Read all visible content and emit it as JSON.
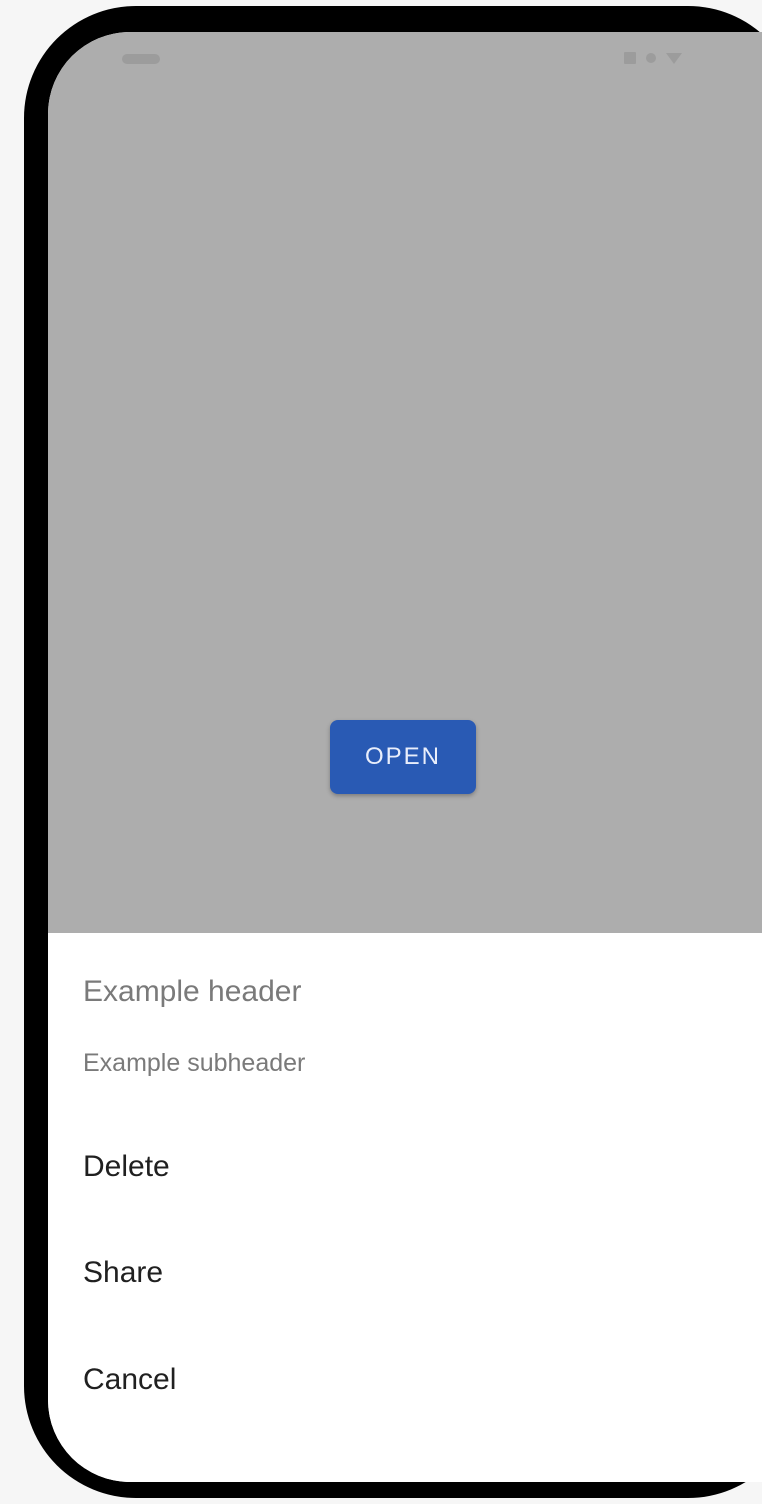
{
  "main": {
    "open_label": "OPEN"
  },
  "bottom_sheet": {
    "header": "Example header",
    "subheader": "Example subheader",
    "actions": [
      {
        "label": "Delete"
      },
      {
        "label": "Share"
      },
      {
        "label": "Cancel"
      }
    ]
  },
  "colors": {
    "scrim": "#adadad",
    "primary_button": "#295ab4",
    "sheet_background": "#ffffff",
    "secondary_text": "#7a7a7a",
    "primary_text": "#202020",
    "device_frame": "#000000"
  },
  "icons": {
    "status_battery": "battery-icon",
    "status_signal": "signal-icon",
    "status_wifi": "wifi-icon"
  }
}
